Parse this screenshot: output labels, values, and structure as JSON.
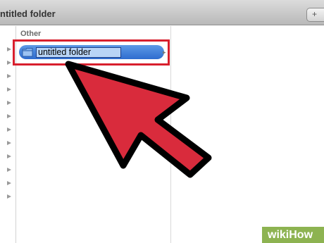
{
  "window": {
    "title": "ntitled folder",
    "toolbar_button_symbol": "+"
  },
  "sidebar": {
    "section_label": "Other",
    "disclosure_triangles": 12
  },
  "finder": {
    "selected_item_name": "untitled folder",
    "selected_item_icon": "folder-icon",
    "row_chevron": "▸"
  },
  "annotation": {
    "arrow_color": "#d92b3c",
    "highlight_color": "#d81f2d"
  },
  "watermark": {
    "text": "wikiHow",
    "brand_color": "#8db351"
  }
}
